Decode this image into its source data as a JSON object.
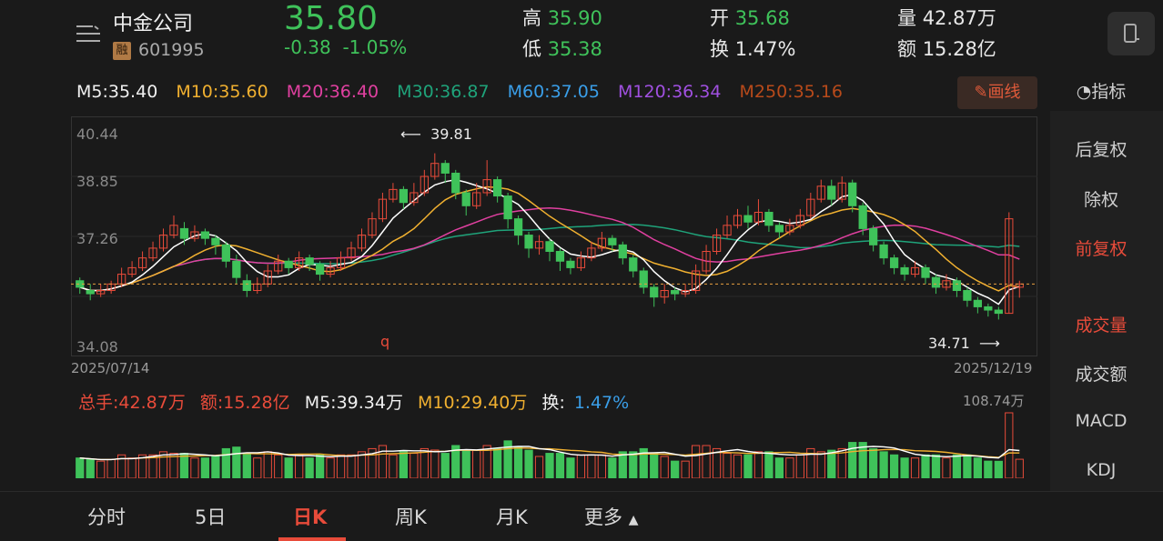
{
  "header": {
    "stock_name": "中金公司",
    "badge": "融",
    "code": "601995",
    "price": "35.80",
    "change": "-0.38",
    "change_pct": "-1.05%",
    "high_label": "高",
    "high": "35.90",
    "low_label": "低",
    "low": "35.38",
    "open_label": "开",
    "open": "35.68",
    "turnover_label": "换",
    "turnover": "1.47%",
    "volume_label": "量",
    "volume": "42.87万",
    "amount_label": "额",
    "amount": "15.28亿"
  },
  "ma": {
    "m5": "M5:35.40",
    "m10": "M10:35.60",
    "m20": "M20:36.40",
    "m30": "M30:36.87",
    "m60": "M60:37.05",
    "m120": "M120:36.34",
    "m250": "M250:35.16"
  },
  "draw_button": "画线",
  "indicator_label": "指标",
  "side_menu": [
    "后复权",
    "除权",
    "前复权",
    "成交量",
    "成交额",
    "MACD",
    "KDJ"
  ],
  "colors": {
    "up": "#e84b3a",
    "down": "#3fc25a",
    "m5": "#ffffff",
    "m10": "#f0b030",
    "m20": "#e040a0",
    "m30": "#1fa37a",
    "m60": "#3a9ee8",
    "m120": "#a050e0",
    "m250": "#b84a1a"
  },
  "price_chart": {
    "y_ticks": [
      "40.44",
      "38.85",
      "37.26",
      "34.08"
    ],
    "high_marker": "39.81",
    "low_marker": "34.71",
    "start_date": "2025/07/14",
    "end_date": "2025/12/19",
    "event_marker": "q"
  },
  "volume": {
    "total": "总手:42.87万",
    "amount": "额:15.28亿",
    "m5": "M5:39.34万",
    "m10": "M10:29.40万",
    "turnover_label": "换:",
    "turnover": "1.47%",
    "max": "108.74万"
  },
  "tabs": [
    "分时",
    "5日",
    "日K",
    "周K",
    "月K",
    "更多"
  ],
  "active_tab": "日K",
  "chart_data": {
    "type": "candlestick",
    "x_range": [
      "2025/07/14",
      "2025/12/19"
    ],
    "ylim": [
      34.08,
      40.44
    ],
    "labeled_extremes": {
      "high": 39.81,
      "low": 34.71
    },
    "last_ma": {
      "M5": 35.4,
      "M10": 35.6,
      "M20": 36.4,
      "M30": 36.87,
      "M60": 37.05,
      "M120": 36.34,
      "M250": 35.16
    },
    "candles": [
      [
        35.9,
        35.7,
        36.0,
        35.5
      ],
      [
        35.6,
        35.5,
        35.8,
        35.3
      ],
      [
        35.5,
        35.6,
        35.8,
        35.4
      ],
      [
        35.6,
        35.8,
        35.9,
        35.5
      ],
      [
        35.8,
        36.1,
        36.3,
        35.7
      ],
      [
        36.1,
        36.3,
        36.5,
        36.0
      ],
      [
        36.3,
        36.6,
        36.8,
        36.2
      ],
      [
        36.6,
        36.9,
        37.1,
        36.5
      ],
      [
        36.9,
        37.3,
        37.5,
        36.8
      ],
      [
        37.3,
        37.6,
        37.9,
        37.2
      ],
      [
        37.5,
        37.2,
        37.7,
        37.0
      ],
      [
        37.2,
        37.4,
        37.6,
        37.1
      ],
      [
        37.4,
        37.2,
        37.5,
        37.0
      ],
      [
        37.2,
        37.0,
        37.3,
        36.7
      ],
      [
        37.0,
        36.5,
        37.1,
        36.3
      ],
      [
        36.5,
        36.0,
        36.7,
        35.8
      ],
      [
        35.9,
        35.6,
        36.1,
        35.4
      ],
      [
        35.6,
        35.8,
        36.0,
        35.5
      ],
      [
        35.8,
        36.2,
        36.4,
        35.7
      ],
      [
        36.2,
        36.5,
        36.7,
        36.1
      ],
      [
        36.5,
        36.3,
        36.6,
        36.1
      ],
      [
        36.3,
        36.6,
        36.8,
        36.2
      ],
      [
        36.6,
        36.4,
        36.7,
        36.2
      ],
      [
        36.4,
        36.1,
        36.5,
        35.9
      ],
      [
        36.1,
        36.3,
        36.5,
        36.0
      ],
      [
        36.3,
        36.6,
        36.8,
        36.2
      ],
      [
        36.6,
        36.9,
        37.1,
        36.5
      ],
      [
        36.9,
        37.3,
        37.5,
        36.8
      ],
      [
        37.3,
        37.8,
        38.0,
        37.2
      ],
      [
        37.8,
        38.4,
        38.6,
        37.7
      ],
      [
        38.4,
        38.7,
        38.9,
        38.3
      ],
      [
        38.7,
        38.3,
        38.8,
        38.1
      ],
      [
        38.3,
        38.6,
        38.9,
        38.2
      ],
      [
        38.6,
        39.1,
        39.3,
        38.5
      ],
      [
        39.1,
        39.5,
        39.81,
        39.0
      ],
      [
        39.5,
        39.2,
        39.6,
        38.9
      ],
      [
        39.2,
        38.6,
        39.3,
        38.4
      ],
      [
        38.6,
        38.2,
        38.7,
        37.9
      ],
      [
        38.2,
        38.6,
        38.9,
        38.1
      ],
      [
        38.6,
        39.0,
        39.6,
        38.5
      ],
      [
        39.0,
        38.5,
        39.1,
        38.3
      ],
      [
        38.5,
        37.8,
        38.6,
        37.5
      ],
      [
        37.8,
        37.3,
        37.9,
        37.0
      ],
      [
        37.3,
        36.9,
        37.4,
        36.6
      ],
      [
        36.9,
        37.1,
        37.3,
        36.7
      ],
      [
        37.1,
        36.8,
        37.2,
        36.5
      ],
      [
        36.8,
        36.5,
        36.9,
        36.2
      ],
      [
        36.5,
        36.3,
        36.6,
        36.1
      ],
      [
        36.3,
        36.6,
        36.8,
        36.2
      ],
      [
        36.6,
        36.9,
        37.1,
        36.5
      ],
      [
        36.9,
        37.2,
        37.4,
        36.8
      ],
      [
        37.2,
        37.0,
        37.3,
        36.8
      ],
      [
        37.0,
        36.6,
        37.1,
        36.4
      ],
      [
        36.6,
        36.2,
        36.7,
        36.0
      ],
      [
        36.2,
        35.7,
        36.3,
        35.5
      ],
      [
        35.7,
        35.4,
        35.8,
        35.1
      ],
      [
        35.4,
        35.6,
        35.8,
        35.2
      ],
      [
        35.6,
        35.5,
        35.7,
        35.3
      ],
      [
        35.5,
        35.6,
        35.8,
        35.4
      ],
      [
        35.6,
        36.2,
        36.4,
        35.5
      ],
      [
        36.2,
        36.8,
        37.0,
        36.1
      ],
      [
        36.8,
        37.3,
        37.5,
        36.7
      ],
      [
        37.3,
        37.6,
        37.9,
        37.2
      ],
      [
        37.6,
        37.9,
        38.1,
        37.5
      ],
      [
        37.9,
        37.7,
        38.2,
        37.5
      ],
      [
        37.7,
        38.0,
        38.4,
        37.6
      ],
      [
        38.0,
        37.6,
        38.1,
        37.4
      ],
      [
        37.6,
        37.4,
        37.7,
        37.2
      ],
      [
        37.4,
        37.6,
        37.8,
        37.3
      ],
      [
        37.6,
        37.9,
        38.1,
        37.5
      ],
      [
        37.9,
        38.4,
        38.6,
        37.8
      ],
      [
        38.4,
        38.8,
        39.0,
        38.3
      ],
      [
        38.8,
        38.4,
        39.0,
        38.2
      ],
      [
        38.4,
        38.9,
        39.1,
        38.3
      ],
      [
        38.9,
        38.2,
        39.0,
        38.0
      ],
      [
        38.2,
        37.5,
        38.3,
        37.3
      ],
      [
        37.5,
        37.0,
        37.6,
        36.8
      ],
      [
        37.0,
        36.6,
        37.1,
        36.4
      ],
      [
        36.6,
        36.3,
        36.7,
        36.1
      ],
      [
        36.3,
        36.1,
        36.4,
        35.9
      ],
      [
        36.1,
        36.3,
        36.5,
        36.0
      ],
      [
        36.3,
        36.0,
        36.4,
        35.8
      ],
      [
        36.0,
        35.7,
        36.1,
        35.5
      ],
      [
        35.7,
        35.9,
        36.1,
        35.6
      ],
      [
        35.9,
        35.6,
        36.0,
        35.4
      ],
      [
        35.6,
        35.3,
        35.7,
        35.1
      ],
      [
        35.3,
        35.1,
        35.4,
        34.9
      ],
      [
        35.1,
        35.0,
        35.2,
        34.8
      ],
      [
        35.0,
        34.9,
        35.1,
        34.71
      ],
      [
        34.9,
        37.8,
        38.0,
        34.9
      ],
      [
        35.7,
        35.8,
        35.9,
        35.38
      ]
    ]
  }
}
